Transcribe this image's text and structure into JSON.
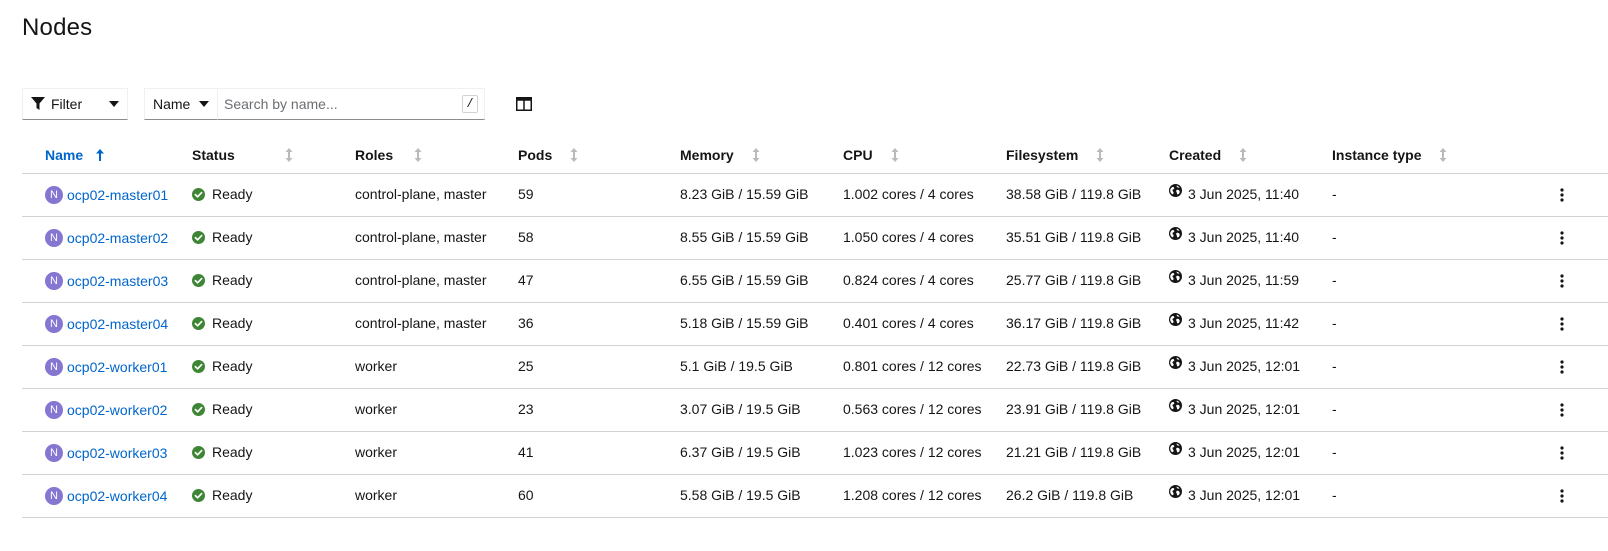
{
  "page": {
    "title": "Nodes"
  },
  "toolbar": {
    "filter_label": "Filter",
    "name_select_label": "Name",
    "search_placeholder": "Search by name...",
    "search_shortcut": "/"
  },
  "table": {
    "columns": [
      "Name",
      "Status",
      "Roles",
      "Pods",
      "Memory",
      "CPU",
      "Filesystem",
      "Created",
      "Instance type"
    ],
    "rows": [
      {
        "badge": "N",
        "name": "ocp02-master01",
        "status": "Ready",
        "roles": "control-plane, master",
        "pods": "59",
        "memory": "8.23 GiB / 15.59 GiB",
        "cpu": "1.002 cores / 4 cores",
        "filesystem": "38.58 GiB / 119.8 GiB",
        "created": "3 Jun 2025, 11:40",
        "instance_type": "-"
      },
      {
        "badge": "N",
        "name": "ocp02-master02",
        "status": "Ready",
        "roles": "control-plane, master",
        "pods": "58",
        "memory": "8.55 GiB / 15.59 GiB",
        "cpu": "1.050 cores / 4 cores",
        "filesystem": "35.51 GiB / 119.8 GiB",
        "created": "3 Jun 2025, 11:40",
        "instance_type": "-"
      },
      {
        "badge": "N",
        "name": "ocp02-master03",
        "status": "Ready",
        "roles": "control-plane, master",
        "pods": "47",
        "memory": "6.55 GiB / 15.59 GiB",
        "cpu": "0.824 cores / 4 cores",
        "filesystem": "25.77 GiB / 119.8 GiB",
        "created": "3 Jun 2025, 11:59",
        "instance_type": "-"
      },
      {
        "badge": "N",
        "name": "ocp02-master04",
        "status": "Ready",
        "roles": "control-plane, master",
        "pods": "36",
        "memory": "5.18 GiB / 15.59 GiB",
        "cpu": "0.401 cores / 4 cores",
        "filesystem": "36.17 GiB / 119.8 GiB",
        "created": "3 Jun 2025, 11:42",
        "instance_type": "-"
      },
      {
        "badge": "N",
        "name": "ocp02-worker01",
        "status": "Ready",
        "roles": "worker",
        "pods": "25",
        "memory": "5.1 GiB / 19.5 GiB",
        "cpu": "0.801 cores / 12 cores",
        "filesystem": "22.73 GiB / 119.8 GiB",
        "created": "3 Jun 2025, 12:01",
        "instance_type": "-"
      },
      {
        "badge": "N",
        "name": "ocp02-worker02",
        "status": "Ready",
        "roles": "worker",
        "pods": "23",
        "memory": "3.07 GiB / 19.5 GiB",
        "cpu": "0.563 cores / 12 cores",
        "filesystem": "23.91 GiB / 119.8 GiB",
        "created": "3 Jun 2025, 12:01",
        "instance_type": "-"
      },
      {
        "badge": "N",
        "name": "ocp02-worker03",
        "status": "Ready",
        "roles": "worker",
        "pods": "41",
        "memory": "6.37 GiB / 19.5 GiB",
        "cpu": "1.023 cores / 12 cores",
        "filesystem": "21.21 GiB / 119.8 GiB",
        "created": "3 Jun 2025, 12:01",
        "instance_type": "-"
      },
      {
        "badge": "N",
        "name": "ocp02-worker04",
        "status": "Ready",
        "roles": "worker",
        "pods": "60",
        "memory": "5.58 GiB / 19.5 GiB",
        "cpu": "1.208 cores / 12 cores",
        "filesystem": "26.2 GiB / 119.8 GiB",
        "created": "3 Jun 2025, 12:01",
        "instance_type": "-"
      }
    ]
  },
  "colors": {
    "link": "#0066cc",
    "node_badge": "#8476d1",
    "ready": "#3e8635",
    "border": "#d2d2d2"
  },
  "icons": {
    "filter": "filter-icon",
    "caret": "caret-down-icon",
    "columns": "columns-icon",
    "sort": "sort-icon",
    "ready": "check-circle-icon",
    "globe": "globe-icon",
    "kebab": "kebab-icon"
  }
}
